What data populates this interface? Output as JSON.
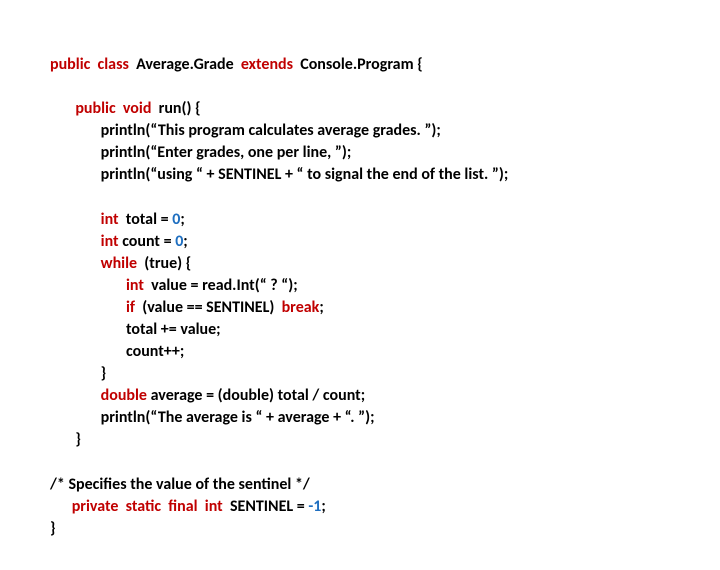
{
  "code": {
    "l1": {
      "k1": "public",
      "k2": "class",
      "t1": "Average.Grade",
      "k3": "extends",
      "t2": "Console.Program {"
    },
    "l3": {
      "k1": "public",
      "k2": "void",
      "t1": "run() {"
    },
    "l4": {
      "t1": "println(“This program calculates average grades. ”);"
    },
    "l5": {
      "t1": "println(“Enter grades, one per line, ”);"
    },
    "l6": {
      "t1": "println(“using “ + SENTINEL + “ to signal the end of the list. ”);"
    },
    "l8": {
      "k1": "int",
      "t1": "total = ",
      "n1": "0",
      "t2": ";"
    },
    "l9": {
      "k1": "int",
      "t1": "count = ",
      "n1": "0",
      "t2": ";"
    },
    "l10": {
      "k1": "while",
      "t1": "(true) {"
    },
    "l11": {
      "k1": "int",
      "t1": "value = read.Int(“ ? “);"
    },
    "l12": {
      "k1": "if",
      "t1": "(value == SENTINEL) ",
      "k2": "break",
      "t2": ";"
    },
    "l13": {
      "t1": "total += value;"
    },
    "l14": {
      "t1": "count++;"
    },
    "l15": {
      "t1": "}"
    },
    "l16": {
      "k1": "double ",
      "t1": "average = (double) total / count;"
    },
    "l17": {
      "t1": "println(“The average is “ + average + “. ”);"
    },
    "l18": {
      "t1": "}"
    },
    "l20": {
      "t1": "/* Specifies the value of the sentinel */"
    },
    "l21": {
      "k1": "private",
      "k2": "static",
      "k3": "final",
      "k4": "int",
      "t1": "SENTINEL = ",
      "n1": "-1",
      "t2": ";"
    },
    "l22": {
      "t1": "}"
    }
  }
}
